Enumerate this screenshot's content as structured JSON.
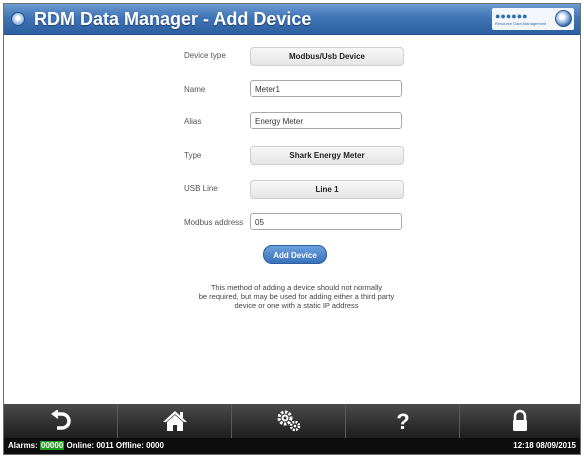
{
  "header": {
    "title": "RDM Data Manager - Add Device",
    "logo_dots": "●●●●●●",
    "logo_sub": "Resource Data Management"
  },
  "form": {
    "device_type": {
      "label": "Device type",
      "value": "Modbus/Usb Device"
    },
    "name": {
      "label": "Name",
      "value": "Meter1"
    },
    "alias": {
      "label": "Alias",
      "value": "Energy Meter"
    },
    "type": {
      "label": "Type",
      "value": "Shark Energy Meter"
    },
    "usb_line": {
      "label": "USB Line",
      "value": "Line 1"
    },
    "modbus_address": {
      "label": "Modbus address",
      "value": "05"
    },
    "add_button": "Add Device",
    "note_lines": [
      "This method of adding a device should not normally",
      "be required, but may be used for adding either a third party",
      "device or one with a static IP address"
    ]
  },
  "toolbar": {
    "buttons": [
      "back-icon",
      "home-icon",
      "settings-gears-icon",
      "help-icon",
      "lock-icon"
    ]
  },
  "status": {
    "alarms_label": "Alarms:",
    "alarms_value": "00000",
    "online_label": "Online:",
    "online_value": "0011",
    "offline_label": "Offline:",
    "offline_value": "0000",
    "datetime": "12:18 08/09/2015"
  },
  "colors": {
    "header_blue": "#3f74b6",
    "button_blue": "#3a72bb",
    "alarm_green": "#1f9a1f",
    "toolbar_dark": "#1e1e1e"
  }
}
